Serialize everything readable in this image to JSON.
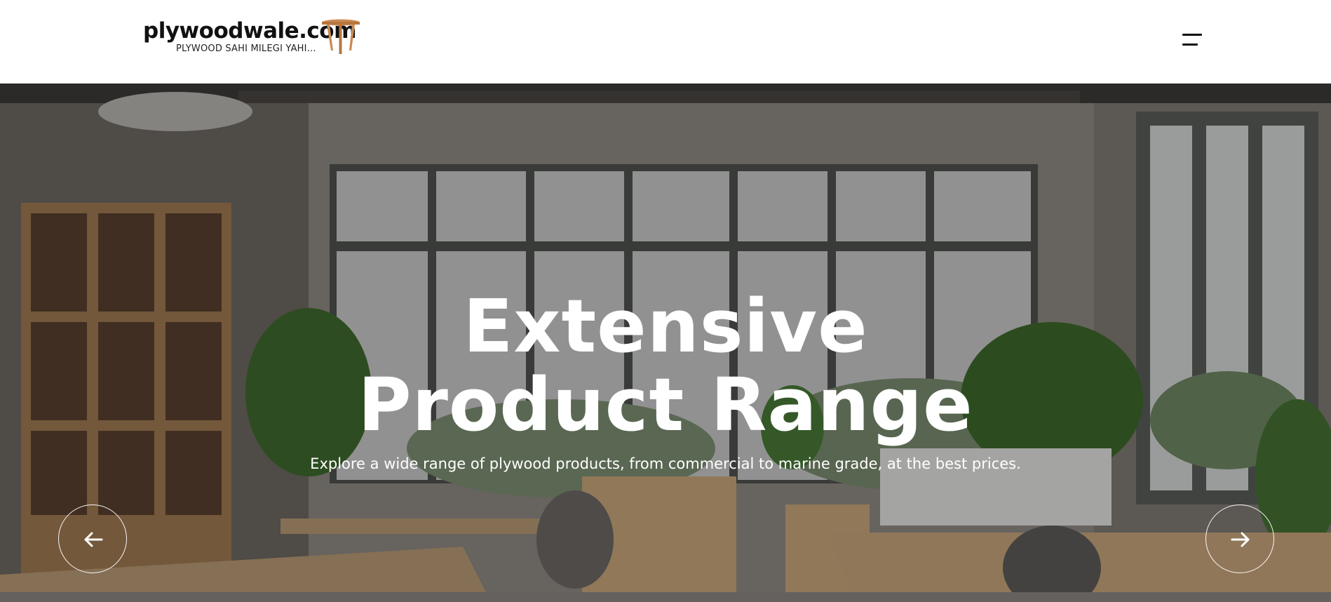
{
  "header": {
    "logo_text": "plywoodwale.com",
    "logo_tagline": "PLYWOOD SAHI MILEGI YAHI...",
    "menu_icon": "hamburger-menu-icon"
  },
  "hero": {
    "title": "Extensive Product Range",
    "subtitle": "Explore a wide range of plywood products, from commercial to marine grade, at the best prices.",
    "prev_icon": "arrow-left-icon",
    "next_icon": "arrow-right-icon"
  },
  "colors": {
    "header_bg": "#ffffff",
    "logo_text": "#111111",
    "logo_table": "#c98a52",
    "hero_text": "#ffffff"
  }
}
